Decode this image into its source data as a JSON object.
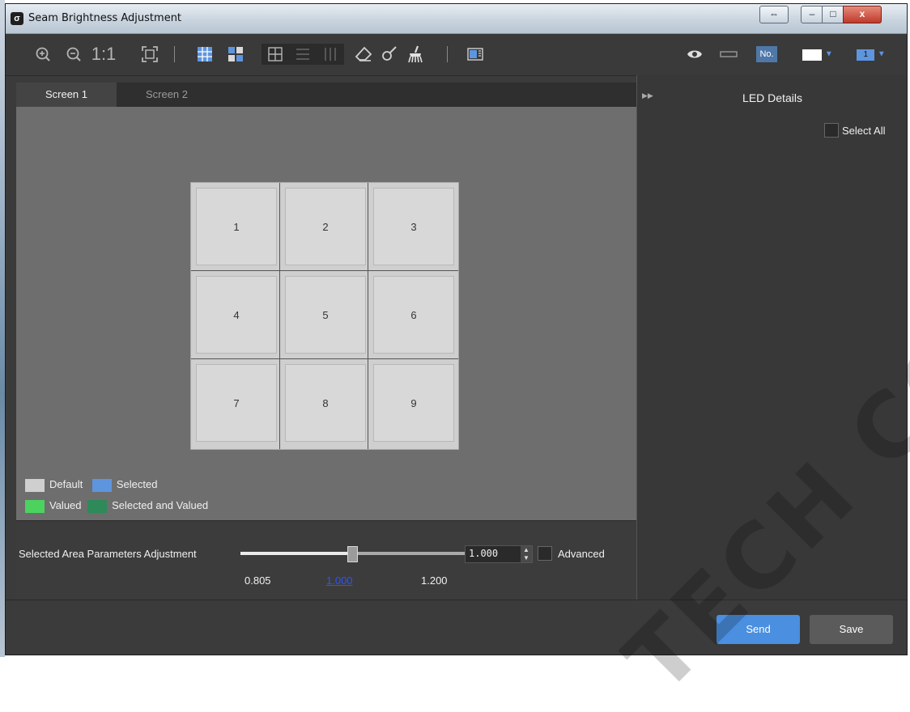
{
  "window": {
    "title": "Seam Brightness Adjustment",
    "logo_glyph": "σ",
    "controls": {
      "resize": "⇔",
      "minimize": "–",
      "maximize": "□",
      "close": "x"
    }
  },
  "toolbar": {
    "zoom_in_icon": "zoom-in",
    "zoom_out_icon": "zoom-out",
    "actual_size_label": "1:1",
    "fit_icon": "fit-to-window",
    "right_tools": {
      "number_label": "No.",
      "screen_number": "1"
    }
  },
  "tabs": [
    "Screen 1",
    "Screen 2"
  ],
  "grid": {
    "cells": [
      "1",
      "2",
      "3",
      "4",
      "5",
      "6",
      "7",
      "8",
      "9"
    ]
  },
  "legend": [
    {
      "label": "Default",
      "color": "#cfcfcf"
    },
    {
      "label": "Selected",
      "color": "#5e95df"
    },
    {
      "label": "Valued",
      "color": "#4cd25f"
    },
    {
      "label": "Selected and Valued",
      "color": "#2e8a58"
    }
  ],
  "params": {
    "label": "Selected Area Parameters Adjustment",
    "min_label": "0.805",
    "current_label": "1.000",
    "max_label": "1.200",
    "slider_fraction": 0.49,
    "spin_value": "1.000",
    "advanced_label": "Advanced"
  },
  "right_panel": {
    "title": "LED Details",
    "select_all_label": "Select All"
  },
  "footer": {
    "send_label": "Send",
    "save_label": "Save"
  },
  "watermark": "TECH CO.,LTD",
  "colors": {
    "accent": "#4a8fe0",
    "panel": "#3b3b3b",
    "canvas": "#6e6e6e"
  }
}
